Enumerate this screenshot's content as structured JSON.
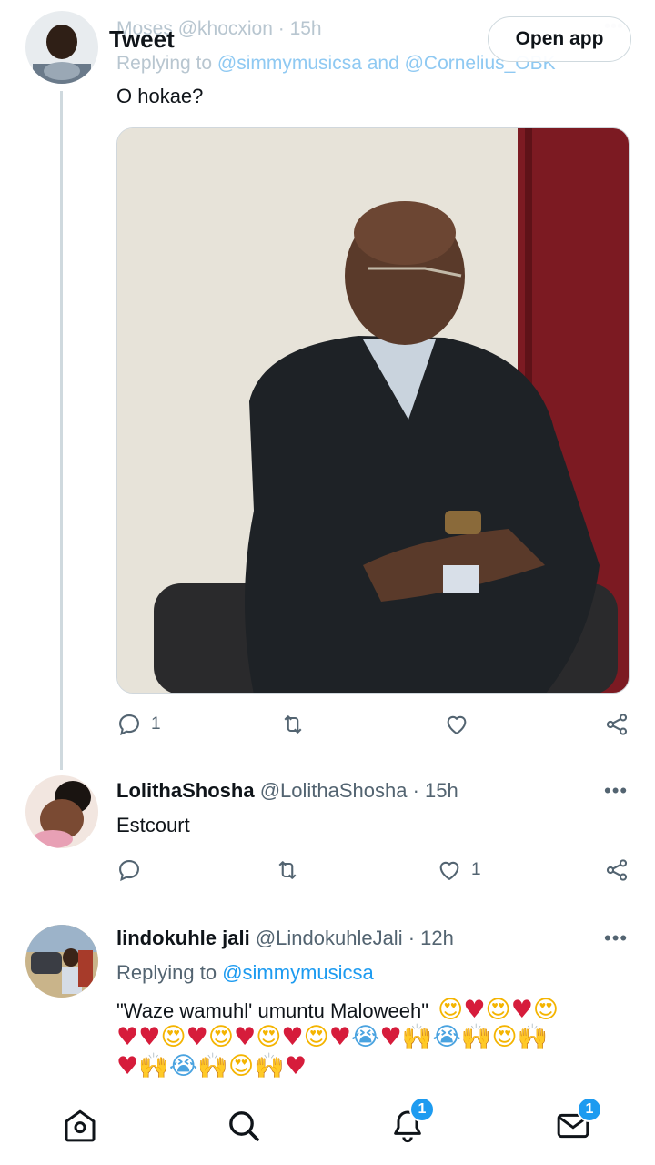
{
  "header": {
    "title": "Tweet",
    "open_app_label": "Open app"
  },
  "tweet1": {
    "faded_name": "Moses",
    "faded_meta": "@khocxion · 15h",
    "faded_replying_prefix": "Replying to",
    "faded_replying_users": "@simmymusicsa and @Cornelius_OBK",
    "text": "O hokae?",
    "reply_count": "1"
  },
  "tweet2": {
    "name": "LolithaShosha",
    "meta": "@LolithaShosha · 15h",
    "text": "Estcourt",
    "like_count": "1"
  },
  "tweet3": {
    "name": "lindokuhle jali",
    "meta": "@LindokuhleJali · 12h",
    "replying_prefix": "Replying to",
    "replying_user": "@simmymusicsa",
    "text": "\"Waze wamuhl' umuntu Maloweeh\""
  },
  "nav": {
    "notifications_badge": "1",
    "messages_badge": "1"
  },
  "colors": {
    "accent": "#1d9bf0",
    "heart": "#d61c3b",
    "muted": "#536471"
  },
  "icons": [
    "back-arrow-icon",
    "reply-icon",
    "retweet-icon",
    "like-icon",
    "share-icon",
    "home-icon",
    "search-icon",
    "bell-icon",
    "mail-icon"
  ]
}
